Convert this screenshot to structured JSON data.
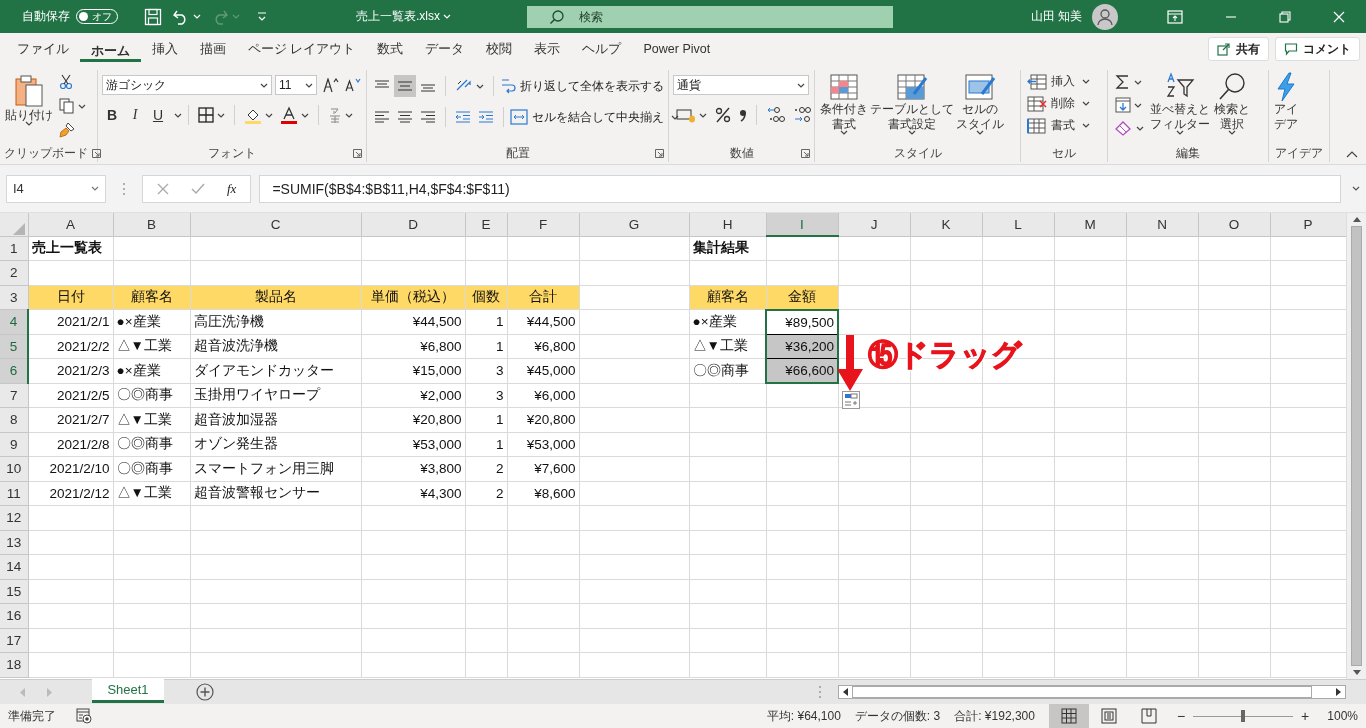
{
  "title_bar": {
    "autosave_label": "自動保存",
    "autosave": {
      "on": false,
      "label": "オフ"
    },
    "redo_disabled": true,
    "file_name": "売上一覧表.xlsx",
    "search_placeholder": "検索",
    "user_name": "山田 知美"
  },
  "ribbon_tabs": [
    {
      "label": "ファイル",
      "selected": false
    },
    {
      "label": "ホーム",
      "selected": true
    },
    {
      "label": "挿入",
      "selected": false
    },
    {
      "label": "描画",
      "selected": false
    },
    {
      "label": "ページ レイアウト",
      "selected": false
    },
    {
      "label": "数式",
      "selected": false
    },
    {
      "label": "データ",
      "selected": false
    },
    {
      "label": "校閲",
      "selected": false
    },
    {
      "label": "表示",
      "selected": false
    },
    {
      "label": "ヘルプ",
      "selected": false
    },
    {
      "label": "Power Pivot",
      "selected": false
    }
  ],
  "share_button": "共有",
  "comment_button": "コメント",
  "ribbon_groups": [
    {
      "kind": "clipboard",
      "label": "クリップボード",
      "launcher": true,
      "paste": "貼り付け"
    },
    {
      "kind": "font",
      "label": "フォント",
      "launcher": true,
      "font_name": "游ゴシック",
      "font_size": "11",
      "bold": "B",
      "italic": "I",
      "underline": "U"
    },
    {
      "kind": "alignment",
      "label": "配置",
      "launcher": true,
      "middle_align_on": true,
      "wrap_text": "折り返して全体を表示する",
      "merge_center": "セルを結合して中央揃え"
    },
    {
      "kind": "number",
      "label": "数値",
      "launcher": true,
      "format": "通貨"
    },
    {
      "kind": "styles",
      "label": "スタイル",
      "launcher": false,
      "buttons": [
        {
          "lines": [
            "条件付き",
            "書式"
          ]
        },
        {
          "lines": [
            "テーブルとして",
            "書式設定"
          ]
        },
        {
          "lines": [
            "セルの",
            "スタイル"
          ]
        }
      ]
    },
    {
      "kind": "cells",
      "label": "セル",
      "launcher": false,
      "buttons": [
        "挿入",
        "削除",
        "書式"
      ]
    },
    {
      "kind": "editing",
      "label": "編集",
      "launcher": false,
      "buttons": [
        {
          "lines": [
            "並べ替えと",
            "フィルター"
          ]
        },
        {
          "lines": [
            "検索と",
            "選択"
          ]
        }
      ]
    },
    {
      "kind": "ideas",
      "label": "アイデア",
      "launcher": false,
      "buttons": [
        {
          "lines": [
            "アイ",
            "デア"
          ]
        }
      ]
    }
  ],
  "formula_bar": {
    "name_box": "I4",
    "function_button": "fx",
    "formula": "=SUMIF($B$4:$B$11,H4,$F$4:$F$11)"
  },
  "sheet": {
    "columns": [
      {
        "label": "A",
        "selected": false
      },
      {
        "label": "B",
        "selected": false
      },
      {
        "label": "C",
        "selected": false
      },
      {
        "label": "D",
        "selected": false
      },
      {
        "label": "E",
        "selected": false
      },
      {
        "label": "F",
        "selected": false
      },
      {
        "label": "G",
        "selected": false
      },
      {
        "label": "H",
        "selected": false
      },
      {
        "label": "I",
        "selected": true
      },
      {
        "label": "J",
        "selected": false
      },
      {
        "label": "K",
        "selected": false
      },
      {
        "label": "L",
        "selected": false
      },
      {
        "label": "M",
        "selected": false
      },
      {
        "label": "N",
        "selected": false
      },
      {
        "label": "O",
        "selected": false
      },
      {
        "label": "P",
        "selected": false
      }
    ],
    "rows": [
      {
        "label": "1",
        "selected": false,
        "cells": [
          {
            "kind": "title",
            "text": "売上一覧表",
            "selected": false,
            "active": false
          },
          "",
          "",
          "",
          "",
          "",
          "",
          {
            "kind": "title",
            "text": "集計結果",
            "selected": false,
            "active": false
          }
        ]
      },
      {
        "label": "2",
        "selected": false,
        "cells": []
      },
      {
        "label": "3",
        "selected": false,
        "cells": [
          {
            "kind": "header",
            "text": "日付",
            "selected": false,
            "active": false
          },
          {
            "kind": "header",
            "text": "顧客名",
            "selected": false,
            "active": false
          },
          {
            "kind": "header",
            "text": "製品名",
            "selected": false,
            "active": false
          },
          {
            "kind": "header",
            "text": "単価（税込）",
            "selected": false,
            "active": false
          },
          {
            "kind": "header",
            "text": "個数",
            "selected": false,
            "active": false
          },
          {
            "kind": "header",
            "text": "合計",
            "selected": false,
            "active": false
          },
          "",
          {
            "kind": "header",
            "text": "顧客名",
            "selected": false,
            "active": false
          },
          {
            "kind": "header",
            "text": "金額",
            "selected": false,
            "active": false
          }
        ]
      },
      {
        "label": "4",
        "selected": true,
        "cells": [
          {
            "kind": "number",
            "text": "2021/2/1",
            "selected": false,
            "active": false
          },
          {
            "kind": "text",
            "text": "●×産業",
            "selected": false,
            "active": false
          },
          {
            "kind": "text",
            "text": "高圧洗浄機",
            "selected": false,
            "active": false
          },
          {
            "kind": "number",
            "text": "¥44,500",
            "selected": false,
            "active": false
          },
          {
            "kind": "number",
            "text": "1",
            "selected": false,
            "active": false
          },
          {
            "kind": "number",
            "text": "¥44,500",
            "selected": false,
            "active": false
          },
          "",
          {
            "kind": "text",
            "text": "●×産業",
            "selected": false,
            "active": false
          },
          {
            "kind": "number",
            "text": "¥89,500",
            "selected": true,
            "active": true
          }
        ]
      },
      {
        "label": "5",
        "selected": true,
        "cells": [
          {
            "kind": "number",
            "text": "2021/2/2",
            "selected": false,
            "active": false
          },
          {
            "kind": "text",
            "text": "△▼工業",
            "selected": false,
            "active": false
          },
          {
            "kind": "text",
            "text": "超音波洗浄機",
            "selected": false,
            "active": false
          },
          {
            "kind": "number",
            "text": "¥6,800",
            "selected": false,
            "active": false
          },
          {
            "kind": "number",
            "text": "1",
            "selected": false,
            "active": false
          },
          {
            "kind": "number",
            "text": "¥6,800",
            "selected": false,
            "active": false
          },
          "",
          {
            "kind": "text",
            "text": "△▼工業",
            "selected": false,
            "active": false
          },
          {
            "kind": "number",
            "text": "¥36,200",
            "selected": true,
            "active": false
          }
        ]
      },
      {
        "label": "6",
        "selected": true,
        "cells": [
          {
            "kind": "number",
            "text": "2021/2/3",
            "selected": false,
            "active": false
          },
          {
            "kind": "text",
            "text": "●×産業",
            "selected": false,
            "active": false
          },
          {
            "kind": "text",
            "text": "ダイアモンドカッター",
            "selected": false,
            "active": false
          },
          {
            "kind": "number",
            "text": "¥15,000",
            "selected": false,
            "active": false
          },
          {
            "kind": "number",
            "text": "3",
            "selected": false,
            "active": false
          },
          {
            "kind": "number",
            "text": "¥45,000",
            "selected": false,
            "active": false
          },
          "",
          {
            "kind": "text",
            "text": "〇◎商事",
            "selected": false,
            "active": false
          },
          {
            "kind": "number",
            "text": "¥66,600",
            "selected": true,
            "active": false
          }
        ]
      },
      {
        "label": "7",
        "selected": false,
        "cells": [
          {
            "kind": "number",
            "text": "2021/2/5",
            "selected": false,
            "active": false
          },
          {
            "kind": "text",
            "text": "〇◎商事",
            "selected": false,
            "active": false
          },
          {
            "kind": "text",
            "text": "玉掛用ワイヤロープ",
            "selected": false,
            "active": false
          },
          {
            "kind": "number",
            "text": "¥2,000",
            "selected": false,
            "active": false
          },
          {
            "kind": "number",
            "text": "3",
            "selected": false,
            "active": false
          },
          {
            "kind": "number",
            "text": "¥6,000",
            "selected": false,
            "active": false
          }
        ]
      },
      {
        "label": "8",
        "selected": false,
        "cells": [
          {
            "kind": "number",
            "text": "2021/2/7",
            "selected": false,
            "active": false
          },
          {
            "kind": "text",
            "text": "△▼工業",
            "selected": false,
            "active": false
          },
          {
            "kind": "text",
            "text": "超音波加湿器",
            "selected": false,
            "active": false
          },
          {
            "kind": "number",
            "text": "¥20,800",
            "selected": false,
            "active": false
          },
          {
            "kind": "number",
            "text": "1",
            "selected": false,
            "active": false
          },
          {
            "kind": "number",
            "text": "¥20,800",
            "selected": false,
            "active": false
          }
        ]
      },
      {
        "label": "9",
        "selected": false,
        "cells": [
          {
            "kind": "number",
            "text": "2021/2/8",
            "selected": false,
            "active": false
          },
          {
            "kind": "text",
            "text": "〇◎商事",
            "selected": false,
            "active": false
          },
          {
            "kind": "text",
            "text": "オゾン発生器",
            "selected": false,
            "active": false
          },
          {
            "kind": "number",
            "text": "¥53,000",
            "selected": false,
            "active": false
          },
          {
            "kind": "number",
            "text": "1",
            "selected": false,
            "active": false
          },
          {
            "kind": "number",
            "text": "¥53,000",
            "selected": false,
            "active": false
          }
        ]
      },
      {
        "label": "10",
        "selected": false,
        "cells": [
          {
            "kind": "number",
            "text": "2021/2/10",
            "selected": false,
            "active": false
          },
          {
            "kind": "text",
            "text": "〇◎商事",
            "selected": false,
            "active": false
          },
          {
            "kind": "text",
            "text": "スマートフォン用三脚",
            "selected": false,
            "active": false
          },
          {
            "kind": "number",
            "text": "¥3,800",
            "selected": false,
            "active": false
          },
          {
            "kind": "number",
            "text": "2",
            "selected": false,
            "active": false
          },
          {
            "kind": "number",
            "text": "¥7,600",
            "selected": false,
            "active": false
          }
        ]
      },
      {
        "label": "11",
        "selected": false,
        "cells": [
          {
            "kind": "number",
            "text": "2021/2/12",
            "selected": false,
            "active": false
          },
          {
            "kind": "text",
            "text": "△▼工業",
            "selected": false,
            "active": false
          },
          {
            "kind": "text",
            "text": "超音波警報センサー",
            "selected": false,
            "active": false
          },
          {
            "kind": "number",
            "text": "¥4,300",
            "selected": false,
            "active": false
          },
          {
            "kind": "number",
            "text": "2",
            "selected": false,
            "active": false
          },
          {
            "kind": "number",
            "text": "¥8,600",
            "selected": false,
            "active": false
          }
        ]
      },
      {
        "label": "12",
        "selected": false,
        "cells": []
      },
      {
        "label": "13",
        "selected": false,
        "cells": []
      },
      {
        "label": "14",
        "selected": false,
        "cells": []
      },
      {
        "label": "15",
        "selected": false,
        "cells": []
      },
      {
        "label": "16",
        "selected": false,
        "cells": []
      },
      {
        "label": "17",
        "selected": false,
        "cells": []
      },
      {
        "label": "18",
        "selected": false,
        "cells": []
      }
    ]
  },
  "annotation": {
    "text": "⑮ドラッグ"
  },
  "sheet_tabs": [
    {
      "label": "Sheet1",
      "selected": true
    }
  ],
  "status_bar": {
    "mode": "準備完了",
    "stats": [
      "平均: ¥64,100",
      "データの個数: 3",
      "合計: ¥192,300"
    ],
    "views": [
      {
        "kind": "normal",
        "selected": true
      },
      {
        "kind": "page_layout",
        "selected": false
      },
      {
        "kind": "page_break",
        "selected": false
      }
    ],
    "zoom_out": "−",
    "zoom_in": "+",
    "zoom": {
      "level": 0.5
    },
    "zoom_text": "100%"
  }
}
